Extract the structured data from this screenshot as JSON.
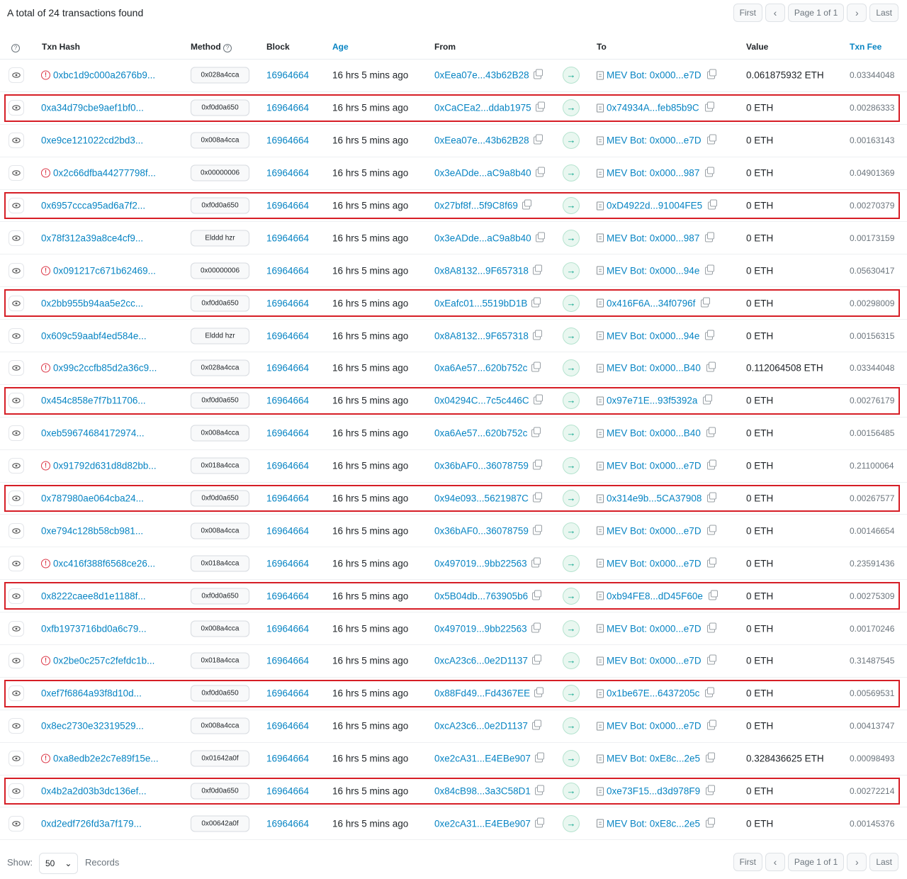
{
  "summary": "A total of 24 transactions found",
  "pagination": {
    "first": "First",
    "prev": "‹",
    "page": "Page 1 of 1",
    "next": "›",
    "last": "Last"
  },
  "headers": {
    "txn_hash": "Txn Hash",
    "method": "Method",
    "block": "Block",
    "age": "Age",
    "from": "From",
    "to": "To",
    "value": "Value",
    "txn_fee": "Txn Fee"
  },
  "rows": [
    {
      "hash": "0xbc1d9c000a2676b9...",
      "error": true,
      "method": "0x028a4cca",
      "block": "16964664",
      "age": "16 hrs 5 mins ago",
      "from": "0xEea07e...43b62B28",
      "to": "MEV Bot: 0x000...e7D",
      "value": "0.061875932 ETH",
      "fee": "0.03344048",
      "highlight": false
    },
    {
      "hash": "0xa34d79cbe9aef1bf0...",
      "error": false,
      "method": "0xf0d0a650",
      "block": "16964664",
      "age": "16 hrs 5 mins ago",
      "from": "0xCaCEa2...ddab1975",
      "to": "0x74934A...feb85b9C",
      "value": "0 ETH",
      "fee": "0.00286333",
      "highlight": true
    },
    {
      "hash": "0xe9ce121022cd2bd3...",
      "error": false,
      "method": "0x008a4cca",
      "block": "16964664",
      "age": "16 hrs 5 mins ago",
      "from": "0xEea07e...43b62B28",
      "to": "MEV Bot: 0x000...e7D",
      "value": "0 ETH",
      "fee": "0.00163143",
      "highlight": false
    },
    {
      "hash": "0x2c66dfba44277798f...",
      "error": true,
      "method": "0x00000006",
      "block": "16964664",
      "age": "16 hrs 5 mins ago",
      "from": "0x3eADde...aC9a8b40",
      "to": "MEV Bot: 0x000...987",
      "value": "0 ETH",
      "fee": "0.04901369",
      "highlight": false
    },
    {
      "hash": "0x6957ccca95ad6a7f2...",
      "error": false,
      "method": "0xf0d0a650",
      "block": "16964664",
      "age": "16 hrs 5 mins ago",
      "from": "0x27bf8f...5f9C8f69",
      "to": "0xD4922d...91004FE5",
      "value": "0 ETH",
      "fee": "0.00270379",
      "highlight": true
    },
    {
      "hash": "0x78f312a39a8ce4cf9...",
      "error": false,
      "method": "Elddd hzr",
      "block": "16964664",
      "age": "16 hrs 5 mins ago",
      "from": "0x3eADde...aC9a8b40",
      "to": "MEV Bot: 0x000...987",
      "value": "0 ETH",
      "fee": "0.00173159",
      "highlight": false
    },
    {
      "hash": "0x091217c671b62469...",
      "error": true,
      "method": "0x00000006",
      "block": "16964664",
      "age": "16 hrs 5 mins ago",
      "from": "0x8A8132...9F657318",
      "to": "MEV Bot: 0x000...94e",
      "value": "0 ETH",
      "fee": "0.05630417",
      "highlight": false
    },
    {
      "hash": "0x2bb955b94aa5e2cc...",
      "error": false,
      "method": "0xf0d0a650",
      "block": "16964664",
      "age": "16 hrs 5 mins ago",
      "from": "0xEafc01...5519bD1B",
      "to": "0x416F6A...34f0796f",
      "value": "0 ETH",
      "fee": "0.00298009",
      "highlight": true
    },
    {
      "hash": "0x609c59aabf4ed584e...",
      "error": false,
      "method": "Elddd hzr",
      "block": "16964664",
      "age": "16 hrs 5 mins ago",
      "from": "0x8A8132...9F657318",
      "to": "MEV Bot: 0x000...94e",
      "value": "0 ETH",
      "fee": "0.00156315",
      "highlight": false
    },
    {
      "hash": "0x99c2ccfb85d2a36c9...",
      "error": true,
      "method": "0x028a4cca",
      "block": "16964664",
      "age": "16 hrs 5 mins ago",
      "from": "0xa6Ae57...620b752c",
      "to": "MEV Bot: 0x000...B40",
      "value": "0.112064508 ETH",
      "fee": "0.03344048",
      "highlight": false
    },
    {
      "hash": "0x454c858e7f7b11706...",
      "error": false,
      "method": "0xf0d0a650",
      "block": "16964664",
      "age": "16 hrs 5 mins ago",
      "from": "0x04294C...7c5c446C",
      "to": "0x97e71E...93f5392a",
      "value": "0 ETH",
      "fee": "0.00276179",
      "highlight": true
    },
    {
      "hash": "0xeb59674684172974...",
      "error": false,
      "method": "0x008a4cca",
      "block": "16964664",
      "age": "16 hrs 5 mins ago",
      "from": "0xa6Ae57...620b752c",
      "to": "MEV Bot: 0x000...B40",
      "value": "0 ETH",
      "fee": "0.00156485",
      "highlight": false
    },
    {
      "hash": "0x91792d631d8d82bb...",
      "error": true,
      "method": "0x018a4cca",
      "block": "16964664",
      "age": "16 hrs 5 mins ago",
      "from": "0x36bAF0...36078759",
      "to": "MEV Bot: 0x000...e7D",
      "value": "0 ETH",
      "fee": "0.21100064",
      "highlight": false
    },
    {
      "hash": "0x787980ae064cba24...",
      "error": false,
      "method": "0xf0d0a650",
      "block": "16964664",
      "age": "16 hrs 5 mins ago",
      "from": "0x94e093...5621987C",
      "to": "0x314e9b...5CA37908",
      "value": "0 ETH",
      "fee": "0.00267577",
      "highlight": true
    },
    {
      "hash": "0xe794c128b58cb981...",
      "error": false,
      "method": "0x008a4cca",
      "block": "16964664",
      "age": "16 hrs 5 mins ago",
      "from": "0x36bAF0...36078759",
      "to": "MEV Bot: 0x000...e7D",
      "value": "0 ETH",
      "fee": "0.00146654",
      "highlight": false
    },
    {
      "hash": "0xc416f388f6568ce26...",
      "error": true,
      "method": "0x018a4cca",
      "block": "16964664",
      "age": "16 hrs 5 mins ago",
      "from": "0x497019...9bb22563",
      "to": "MEV Bot: 0x000...e7D",
      "value": "0 ETH",
      "fee": "0.23591436",
      "highlight": false
    },
    {
      "hash": "0x8222caee8d1e1188f...",
      "error": false,
      "method": "0xf0d0a650",
      "block": "16964664",
      "age": "16 hrs 5 mins ago",
      "from": "0x5B04db...763905b6",
      "to": "0xb94FE8...dD45F60e",
      "value": "0 ETH",
      "fee": "0.00275309",
      "highlight": true
    },
    {
      "hash": "0xfb1973716bd0a6c79...",
      "error": false,
      "method": "0x008a4cca",
      "block": "16964664",
      "age": "16 hrs 5 mins ago",
      "from": "0x497019...9bb22563",
      "to": "MEV Bot: 0x000...e7D",
      "value": "0 ETH",
      "fee": "0.00170246",
      "highlight": false
    },
    {
      "hash": "0x2be0c257c2fefdc1b...",
      "error": true,
      "method": "0x018a4cca",
      "block": "16964664",
      "age": "16 hrs 5 mins ago",
      "from": "0xcA23c6...0e2D1137",
      "to": "MEV Bot: 0x000...e7D",
      "value": "0 ETH",
      "fee": "0.31487545",
      "highlight": false
    },
    {
      "hash": "0xef7f6864a93f8d10d...",
      "error": false,
      "method": "0xf0d0a650",
      "block": "16964664",
      "age": "16 hrs 5 mins ago",
      "from": "0x88Fd49...Fd4367EE",
      "to": "0x1be67E...6437205c",
      "value": "0 ETH",
      "fee": "0.00569531",
      "highlight": true
    },
    {
      "hash": "0x8ec2730e32319529...",
      "error": false,
      "method": "0x008a4cca",
      "block": "16964664",
      "age": "16 hrs 5 mins ago",
      "from": "0xcA23c6...0e2D1137",
      "to": "MEV Bot: 0x000...e7D",
      "value": "0 ETH",
      "fee": "0.00413747",
      "highlight": false
    },
    {
      "hash": "0xa8edb2e2c7e89f15e...",
      "error": true,
      "method": "0x01642a0f",
      "block": "16964664",
      "age": "16 hrs 5 mins ago",
      "from": "0xe2cA31...E4EBe907",
      "to": "MEV Bot: 0xE8c...2e5",
      "value": "0.328436625 ETH",
      "fee": "0.00098493",
      "highlight": false
    },
    {
      "hash": "0x4b2a2d03b3dc136ef...",
      "error": false,
      "method": "0xf0d0a650",
      "block": "16964664",
      "age": "16 hrs 5 mins ago",
      "from": "0x84cB98...3a3C58D1",
      "to": "0xe73F15...d3d978F9",
      "value": "0 ETH",
      "fee": "0.00272214",
      "highlight": true
    },
    {
      "hash": "0xd2edf726fd3a7f179...",
      "error": false,
      "method": "0x00642a0f",
      "block": "16964664",
      "age": "16 hrs 5 mins ago",
      "from": "0xe2cA31...E4EBe907",
      "to": "MEV Bot: 0xE8c...2e5",
      "value": "0 ETH",
      "fee": "0.00145376",
      "highlight": false
    }
  ],
  "footer": {
    "show_label": "Show:",
    "records_value": "50",
    "records_label": "Records"
  },
  "colors": {
    "link": "#0784c3",
    "highlight_border": "#d61e26",
    "error": "#dc3545",
    "arrow_green": "#00a186"
  }
}
